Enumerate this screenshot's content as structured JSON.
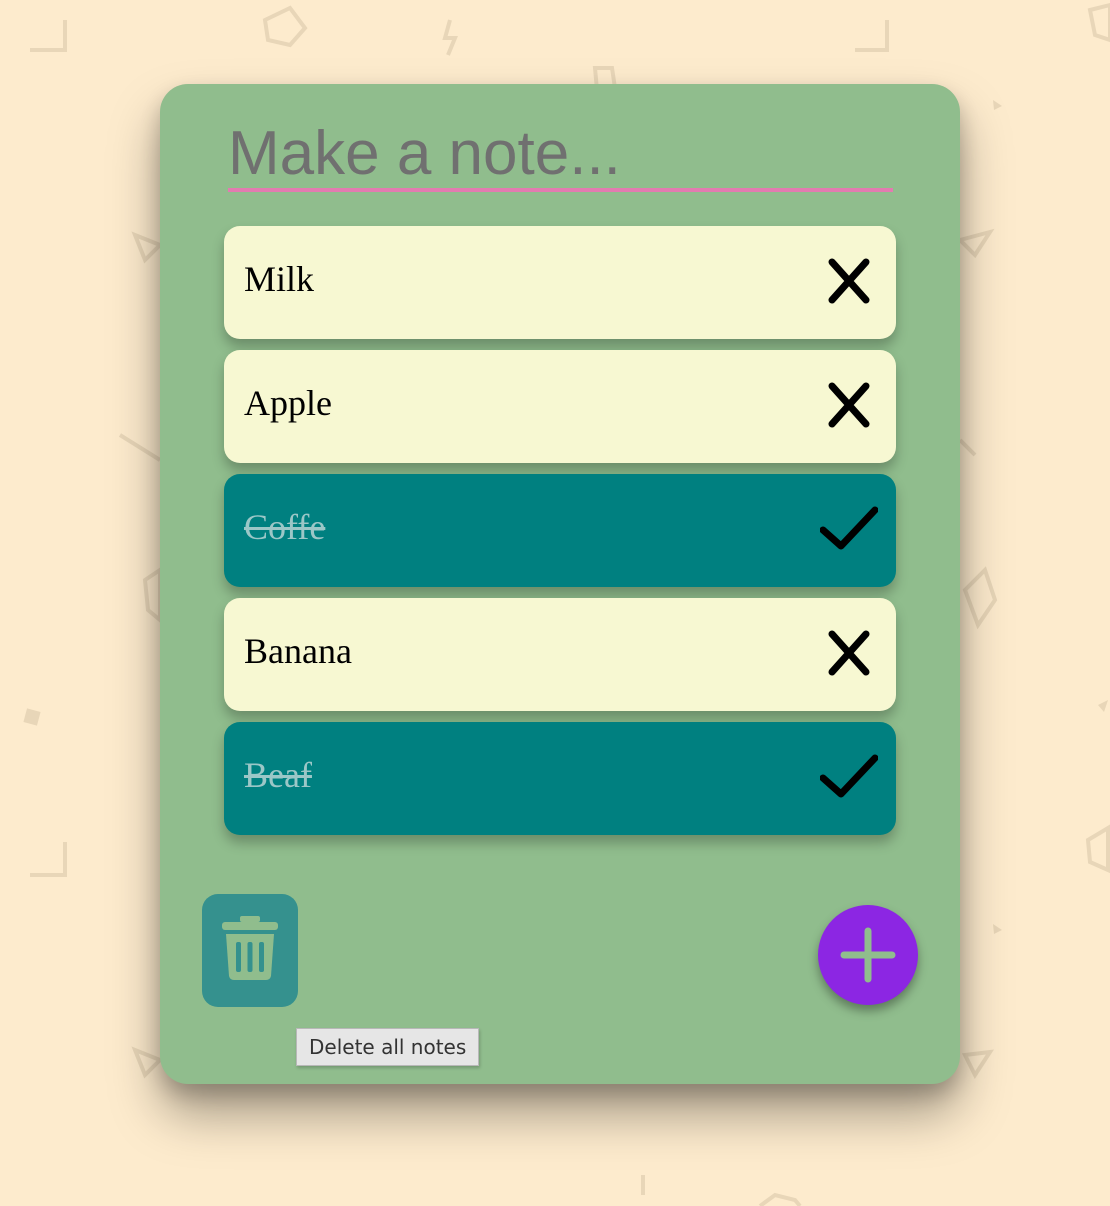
{
  "input": {
    "placeholder": "Make a note...",
    "value": ""
  },
  "notes": [
    {
      "text": "Milk",
      "done": false,
      "action_icon": "close-icon"
    },
    {
      "text": "Apple",
      "done": false,
      "action_icon": "close-icon"
    },
    {
      "text": "Coffe",
      "done": true,
      "action_icon": "check-icon"
    },
    {
      "text": "Banana",
      "done": false,
      "action_icon": "close-icon"
    },
    {
      "text": "Beaf",
      "done": true,
      "action_icon": "check-icon"
    }
  ],
  "footer": {
    "delete_icon": "trash-icon",
    "delete_tooltip": "Delete all notes",
    "add_icon": "plus-icon"
  },
  "colors": {
    "background": "#fdebcd",
    "card": "#90bd8d",
    "note_pending": "#f7f8d2",
    "note_done": "#008080",
    "input_underline": "#e37bb0",
    "add_button": "#8c26e3",
    "trash_button": "#35918e"
  }
}
